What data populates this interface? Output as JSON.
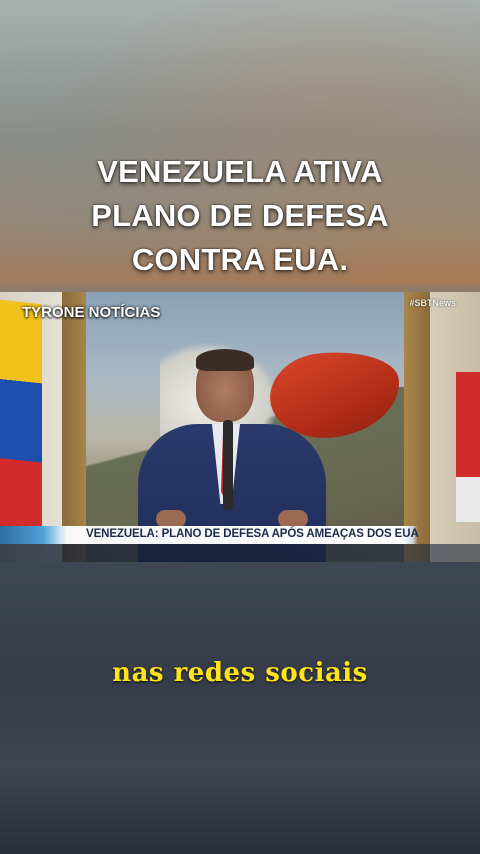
{
  "headline": {
    "lines": [
      "VENEZUELA ATIVA",
      "PLANO DE DEFESA",
      "CONTRA EUA."
    ]
  },
  "video": {
    "channel_label": "TYRONE NOTÍCIAS",
    "watermark": "#SBTNews",
    "lower_third": "VENEZUELA: PLANO DE DEFESA APÓS AMEAÇAS DOS EUA"
  },
  "caption": {
    "text": "nas redes sociais",
    "color": "#ffe41a"
  }
}
